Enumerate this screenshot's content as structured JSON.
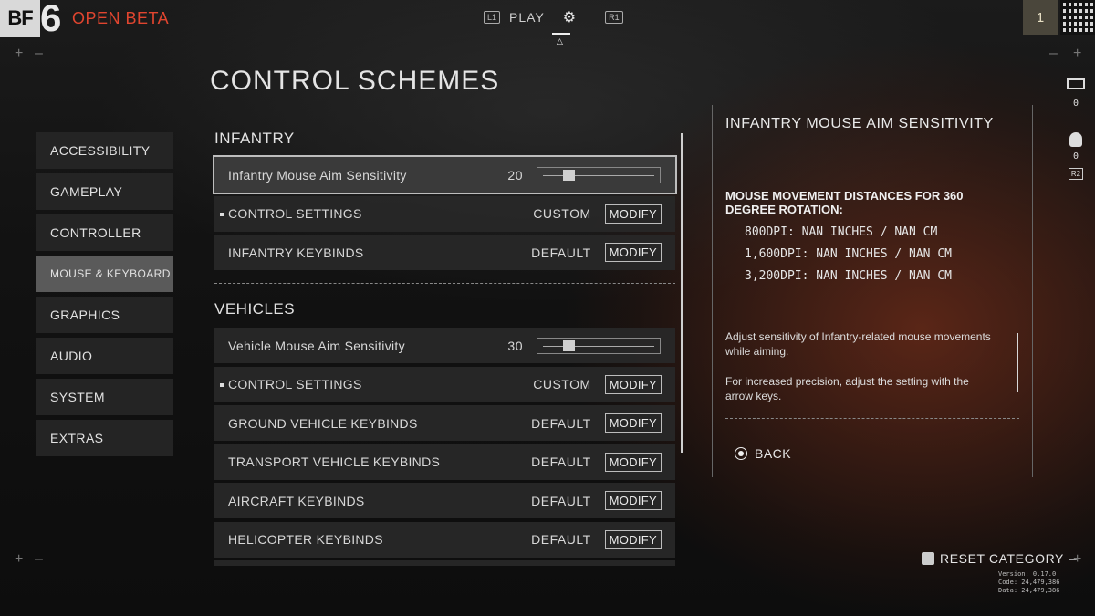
{
  "header": {
    "logo_bf": "BF",
    "logo_six": "6",
    "tag": "OPEN BETA",
    "l1": "L1",
    "play": "PLAY",
    "r1": "R1",
    "rank": "1"
  },
  "page_title": "CONTROL SCHEMES",
  "sidebar": {
    "items": [
      {
        "label": "ACCESSIBILITY"
      },
      {
        "label": "GAMEPLAY"
      },
      {
        "label": "CONTROLLER"
      },
      {
        "label": "MOUSE & KEYBOARD",
        "active": true
      },
      {
        "label": "GRAPHICS"
      },
      {
        "label": "AUDIO"
      },
      {
        "label": "SYSTEM"
      },
      {
        "label": "EXTRAS"
      }
    ]
  },
  "infantry": {
    "title": "INFANTRY",
    "aim_label": "Infantry Mouse Aim Sensitivity",
    "aim_value": "20",
    "aim_fraction": 0.2,
    "control_label": "CONTROL SETTINGS",
    "control_value": "CUSTOM",
    "keybinds_label": "INFANTRY KEYBINDS",
    "keybinds_value": "DEFAULT"
  },
  "vehicles": {
    "title": "VEHICLES",
    "aim_label": "Vehicle Mouse Aim Sensitivity",
    "aim_value": "30",
    "aim_fraction": 0.2,
    "control_label": "CONTROL SETTINGS",
    "control_value": "CUSTOM",
    "ground_label": "GROUND VEHICLE KEYBINDS",
    "ground_value": "DEFAULT",
    "transport_label": "TRANSPORT VEHICLE KEYBINDS",
    "transport_value": "DEFAULT",
    "aircraft_label": "AIRCRAFT KEYBINDS",
    "aircraft_value": "DEFAULT",
    "heli_label": "HELICOPTER KEYBINDS",
    "heli_value": "DEFAULT"
  },
  "modify_label": "MODIFY",
  "info": {
    "title": "INFANTRY MOUSE AIM SENSITIVITY",
    "heading": "MOUSE MOVEMENT DISTANCES FOR 360 DEGREE ROTATION:",
    "dpi_rows": [
      "800DPI:  NAN INCHES / NAN CM",
      "1,600DPI:  NAN INCHES / NAN CM",
      "3,200DPI:  NAN INCHES / NAN CM"
    ],
    "desc1": "Adjust sensitivity of Infantry-related mouse movements while aiming.",
    "desc2": "For increased precision, adjust the setting with the arrow keys.",
    "back": "BACK"
  },
  "rail": {
    "mail_count": "0",
    "party_count": "0",
    "r2": "R2"
  },
  "footer": {
    "reset": "RESET CATEGORY",
    "version": "Version: 0.17.0",
    "code": "Code: 24,479,386",
    "data": "Data: 24,479,386"
  }
}
